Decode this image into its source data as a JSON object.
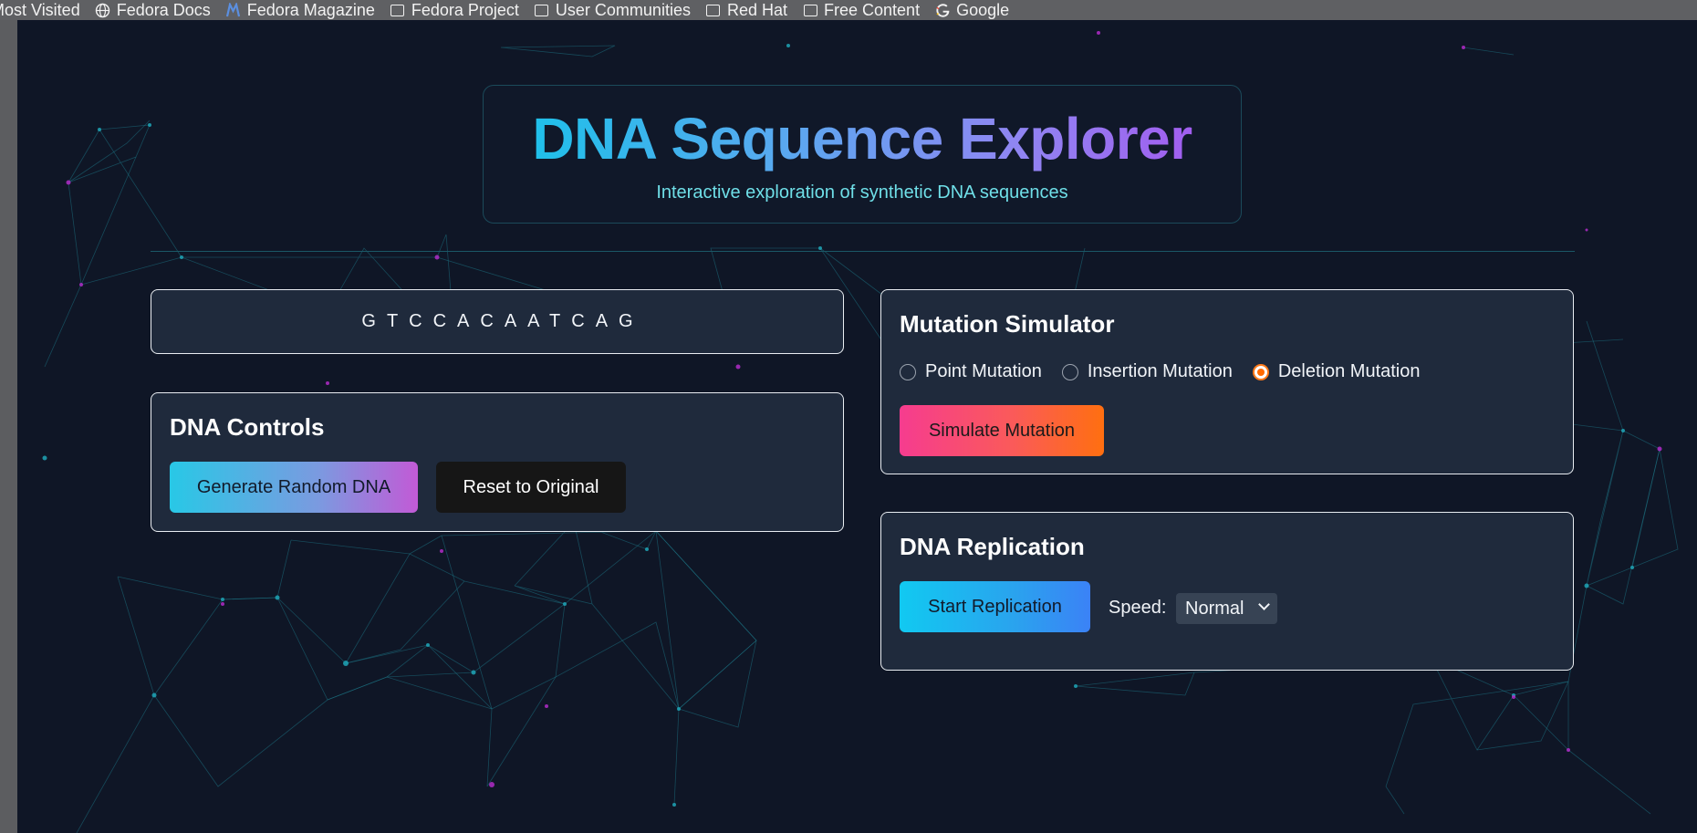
{
  "browser": {
    "bookmarks": [
      {
        "label": "Most Visited",
        "icon": "none"
      },
      {
        "label": "Fedora Docs",
        "icon": "globe-icon"
      },
      {
        "label": "Fedora Magazine",
        "icon": "fedora-magazine-icon"
      },
      {
        "label": "Fedora Project",
        "icon": "folder-icon"
      },
      {
        "label": "User Communities",
        "icon": "folder-icon"
      },
      {
        "label": "Red Hat",
        "icon": "folder-icon"
      },
      {
        "label": "Free Content",
        "icon": "folder-icon"
      },
      {
        "label": "Google",
        "icon": "google-icon"
      }
    ]
  },
  "header": {
    "title": "DNA Sequence Explorer",
    "subtitle": "Interactive exploration of synthetic DNA sequences"
  },
  "sequence": {
    "text": "GTCCACAATCAG"
  },
  "controls": {
    "title": "DNA Controls",
    "generate_label": "Generate Random DNA",
    "reset_label": "Reset to Original"
  },
  "mutation": {
    "title": "Mutation Simulator",
    "options": [
      {
        "label": "Point Mutation",
        "checked": false
      },
      {
        "label": "Insertion Mutation",
        "checked": false
      },
      {
        "label": "Deletion Mutation",
        "checked": true
      }
    ],
    "simulate_label": "Simulate Mutation"
  },
  "replication": {
    "title": "DNA Replication",
    "start_label": "Start Replication",
    "speed_label": "Speed:",
    "speed_value": "Normal"
  },
  "colors": {
    "background": "#0f1626",
    "card": "#1f2a3c",
    "accent_cyan": "#14c4e8",
    "accent_purple": "#a653ee",
    "accent_orange": "#ff6f10"
  }
}
